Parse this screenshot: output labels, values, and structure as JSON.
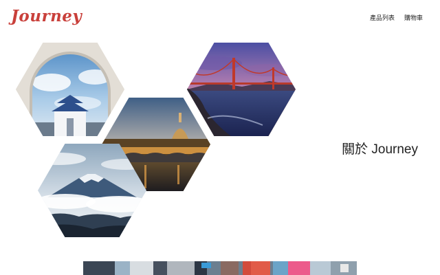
{
  "brand": {
    "name": "Journey",
    "color": "#c9403b"
  },
  "nav": {
    "items": [
      {
        "label": "產品列表"
      },
      {
        "label": "購物車"
      }
    ]
  },
  "gallery": {
    "tiles": [
      {
        "icon": "memorial-hall-arch-photo"
      },
      {
        "icon": "rome-river-dusk-photo"
      },
      {
        "icon": "golden-gate-sunset-photo"
      },
      {
        "icon": "mount-fuji-clouds-photo"
      }
    ]
  },
  "about": {
    "heading": "關於 Journey"
  },
  "city_strip": {
    "icon": "city-street-photo"
  }
}
